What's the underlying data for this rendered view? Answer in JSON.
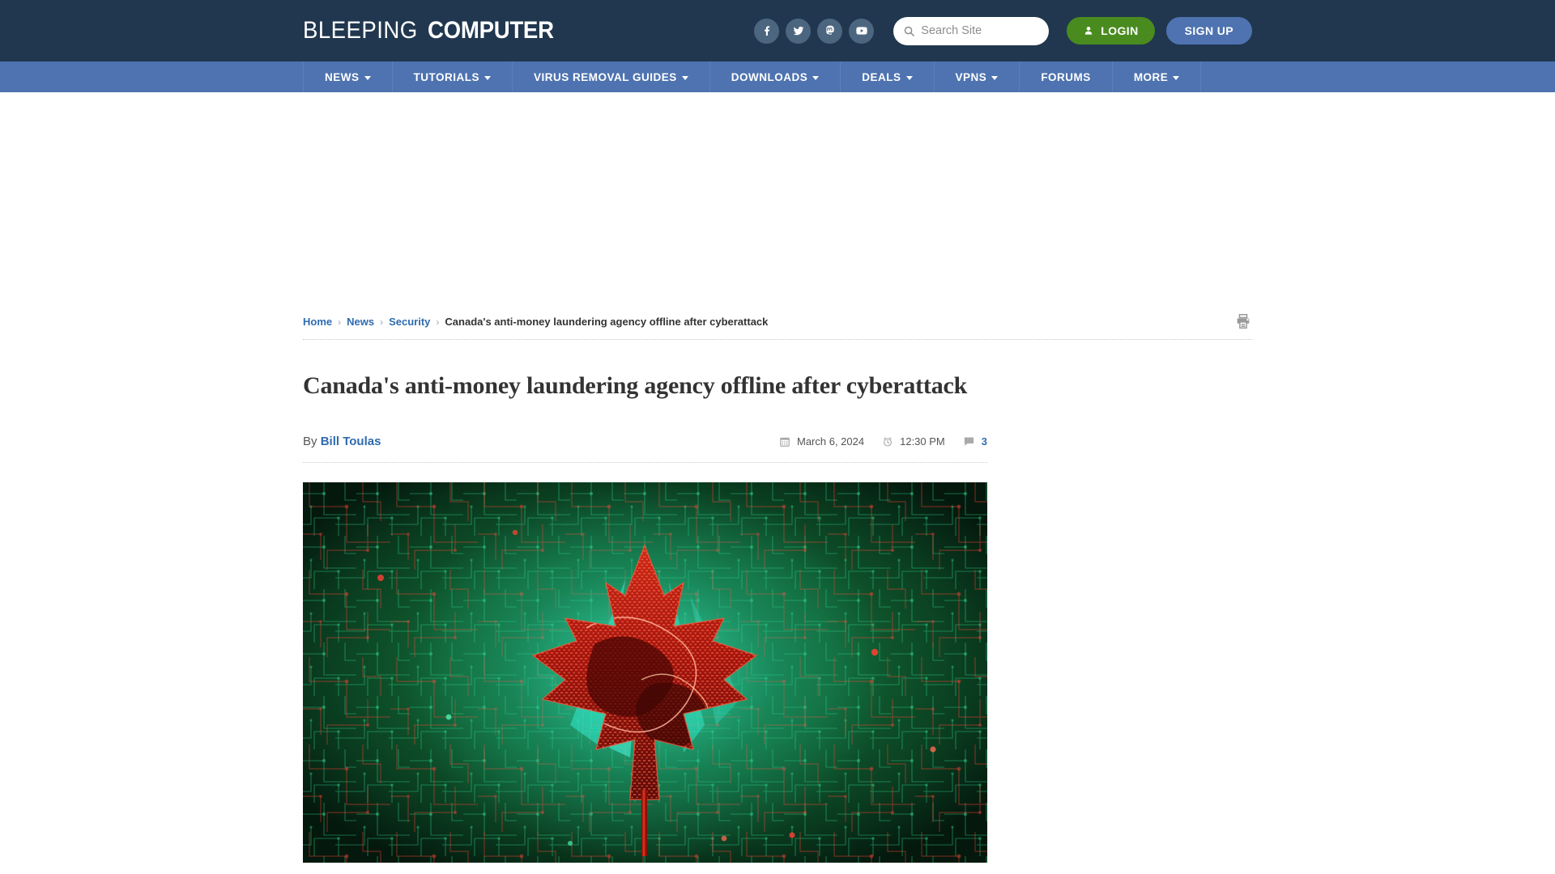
{
  "site": {
    "logo_thin": "BLEEPING",
    "logo_bold": "COMPUTER"
  },
  "header": {
    "social": [
      {
        "name": "facebook-icon",
        "label": "Facebook"
      },
      {
        "name": "twitter-icon",
        "label": "Twitter"
      },
      {
        "name": "mastodon-icon",
        "label": "Mastodon"
      },
      {
        "name": "youtube-icon",
        "label": "YouTube"
      }
    ],
    "search": {
      "placeholder": "Search Site",
      "value": ""
    },
    "login_label": "LOGIN",
    "signup_label": "SIGN UP",
    "login_color": "#4a8b1f",
    "signup_color": "#4e73b0",
    "bar_color": "#21374f"
  },
  "nav": {
    "bar_color": "#4e73b0",
    "items": [
      {
        "label": "NEWS",
        "has_caret": true
      },
      {
        "label": "TUTORIALS",
        "has_caret": true
      },
      {
        "label": "VIRUS REMOVAL GUIDES",
        "has_caret": true
      },
      {
        "label": "DOWNLOADS",
        "has_caret": true
      },
      {
        "label": "DEALS",
        "has_caret": true
      },
      {
        "label": "VPNS",
        "has_caret": true
      },
      {
        "label": "FORUMS",
        "has_caret": false
      },
      {
        "label": "MORE",
        "has_caret": true
      }
    ]
  },
  "breadcrumb": {
    "separator": "›",
    "items": [
      {
        "label": "Home",
        "link": true
      },
      {
        "label": "News",
        "link": true
      },
      {
        "label": "Security",
        "link": true
      },
      {
        "label": "Canada's anti-money laundering agency offline after cyberattack",
        "link": false
      }
    ]
  },
  "article": {
    "title": "Canada's anti-money laundering agency offline after cyberattack",
    "by_prefix": "By",
    "author": "Bill Toulas",
    "date": "March 6, 2024",
    "time": "12:30 PM",
    "comment_count": "3",
    "hero_alt": "Digital red maple leaf over green circuit board"
  },
  "icons": {
    "print": "printer-icon",
    "calendar": "calendar-icon",
    "clock": "alarm-clock-icon",
    "comment": "comment-bubble-icon",
    "search": "search-icon",
    "user": "user-icon"
  }
}
